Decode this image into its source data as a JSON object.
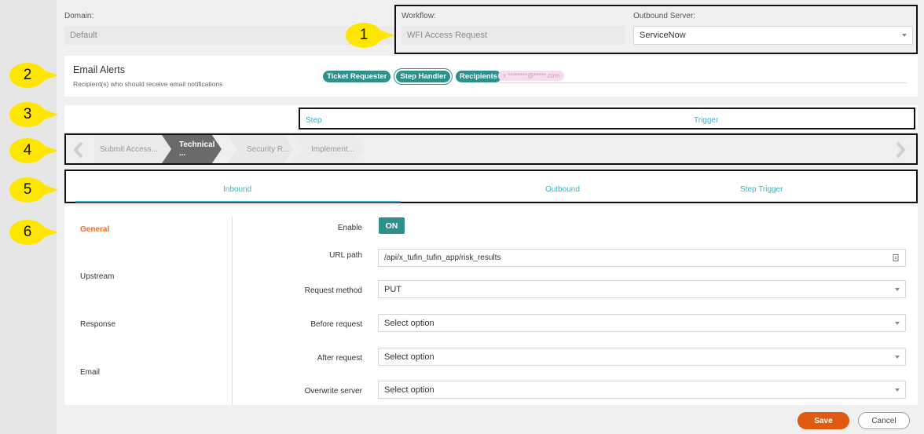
{
  "header": {
    "domain_label": "Domain:",
    "domain_value": "Default",
    "workflow_label": "Workflow:",
    "workflow_value": "WFI Access Request",
    "server_label": "Outbound Server:",
    "server_value": "ServiceNow"
  },
  "callouts": [
    "1",
    "2",
    "3",
    "4",
    "5",
    "6"
  ],
  "email_alerts": {
    "title": "Email Alerts",
    "subtitle": "Recipient(s) who should receive email notifications",
    "chips": [
      "Ticket Requester",
      "Step Handler",
      "Recipients"
    ],
    "email_value": "x  ********@*****.com"
  },
  "step_trigger": {
    "step_label": "Step",
    "trigger_label": "Trigger"
  },
  "steps": [
    "Submit Access...",
    "Technical ...",
    "Security R...",
    "Implement..."
  ],
  "active_step_index": 1,
  "tabs": [
    "Inbound",
    "Outbound",
    "Step Trigger"
  ],
  "active_tab_index": 0,
  "sidebar": [
    "General",
    "Upstream",
    "Response",
    "Email"
  ],
  "active_sidebar_index": 0,
  "form": {
    "enable_label": "Enable",
    "enable_value": "ON",
    "url_label": "URL path",
    "url_value": "/api/x_tufin_tufin_app/risk_results",
    "method_label": "Request method",
    "method_value": "PUT",
    "before_label": "Before request",
    "before_value": "Select option",
    "after_label": "After request",
    "after_value": "Select option",
    "overwrite_label": "Overwrite server",
    "overwrite_value": "Select option"
  },
  "footer": {
    "save_label": "Save",
    "cancel_label": "Cancel"
  },
  "colors": {
    "accent_teal": "#35b3c8",
    "chip_teal": "#2f8f8a",
    "save_orange": "#e05a12",
    "active_orange": "#e8702a",
    "callout_yellow": "#ffe600"
  }
}
